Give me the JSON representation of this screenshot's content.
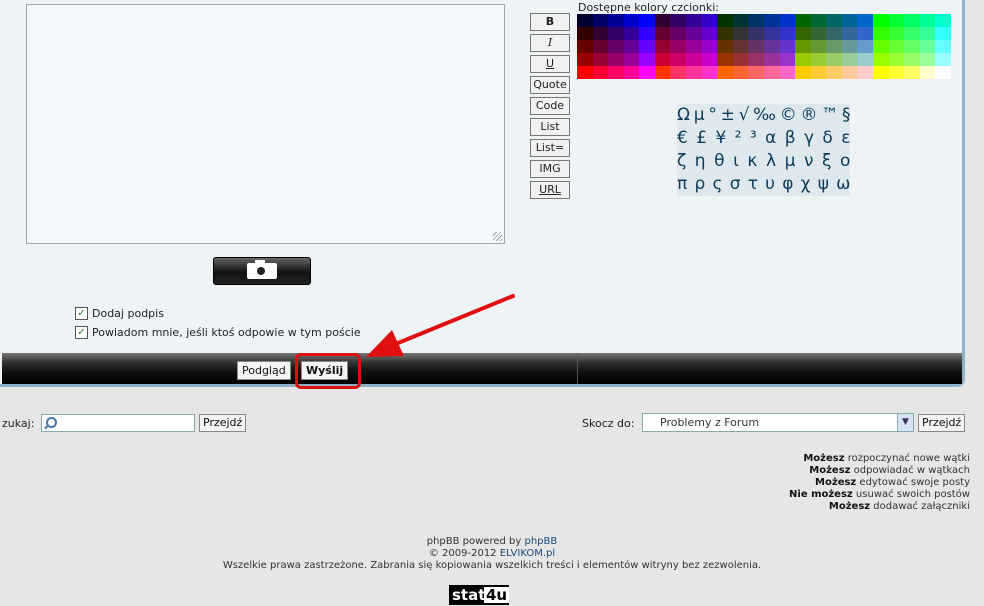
{
  "format_buttons": [
    "B",
    "I",
    "U",
    "Quote",
    "Code",
    "List",
    "List=",
    "IMG",
    "URL"
  ],
  "colors_label": "Dostępne kolory czcionki:",
  "palette_rows": [
    [
      "#000033",
      "#000066",
      "#000099",
      "#0000cc",
      "#0000ff",
      "#330033",
      "#330066",
      "#330099",
      "#3300cc",
      "#003300",
      "#003333",
      "#003366",
      "#003399",
      "#0033cc",
      "#006600",
      "#006633",
      "#006666",
      "#006699",
      "#0066cc",
      "#00ff00",
      "#00ff33",
      "#00ff66",
      "#00ff99",
      "#00ffcc"
    ],
    [
      "#330000",
      "#330033",
      "#330066",
      "#330099",
      "#3300ff",
      "#660033",
      "#660066",
      "#660099",
      "#6600cc",
      "#333300",
      "#333333",
      "#333366",
      "#333399",
      "#3333cc",
      "#336600",
      "#336633",
      "#336666",
      "#336699",
      "#3366cc",
      "#33ff00",
      "#33ff33",
      "#33ff66",
      "#33ff99",
      "#33ffff"
    ],
    [
      "#660000",
      "#660033",
      "#660066",
      "#660099",
      "#6600ff",
      "#990033",
      "#990066",
      "#990099",
      "#9900cc",
      "#663300",
      "#663333",
      "#663366",
      "#663399",
      "#6633cc",
      "#669900",
      "#669933",
      "#669966",
      "#669999",
      "#6699cc",
      "#66ff00",
      "#66ff33",
      "#66ff66",
      "#66ff99",
      "#66ffff"
    ],
    [
      "#990000",
      "#990033",
      "#990066",
      "#990099",
      "#9900ff",
      "#cc0033",
      "#cc0066",
      "#cc0099",
      "#cc00cc",
      "#993300",
      "#993333",
      "#993366",
      "#993399",
      "#9933cc",
      "#99cc00",
      "#99cc33",
      "#99cc66",
      "#99cc99",
      "#99cccc",
      "#99ff00",
      "#99ff33",
      "#99ff66",
      "#99ff99",
      "#99ffff"
    ],
    [
      "#ff0000",
      "#ff0033",
      "#ff0066",
      "#ff0099",
      "#ff00ff",
      "#ff3300",
      "#ff3366",
      "#ff3399",
      "#ff33cc",
      "#ff6600",
      "#ff6633",
      "#ff6666",
      "#ff6699",
      "#ff66cc",
      "#ffcc00",
      "#ffcc33",
      "#ffcc66",
      "#ffcc99",
      "#ffcccc",
      "#ffff00",
      "#ffff33",
      "#ffff66",
      "#ffffcc",
      "#ffffff"
    ]
  ],
  "symbol_rows": [
    [
      "Ω",
      "µ",
      "°",
      "±",
      "√",
      "‰",
      "©",
      "®",
      "™",
      "§"
    ],
    [
      "€",
      "£",
      "¥",
      "²",
      "³",
      "α",
      "β",
      "γ",
      "δ",
      "ε"
    ],
    [
      "ζ",
      "η",
      "θ",
      "ι",
      "κ",
      "λ",
      "μ",
      "ν",
      "ξ",
      "ο"
    ],
    [
      "π",
      "ρ",
      "ς",
      "σ",
      "τ",
      "υ",
      "φ",
      "χ",
      "ψ",
      "ω"
    ]
  ],
  "options": {
    "signature": "Dodaj podpis",
    "notify": "Powiadom mnie, jeśli ktoś odpowie w tym poście"
  },
  "actions": {
    "preview": "Podgląd",
    "submit": "Wyślij"
  },
  "search": {
    "label": "zukaj:",
    "go": "Przejdź"
  },
  "jump": {
    "label": "Skocz do:",
    "selected": "Problemy z Forum",
    "go": "Przejdź"
  },
  "permissions": [
    {
      "b": "Możesz",
      "t": " rozpoczynać nowe wątki"
    },
    {
      "b": "Możesz",
      "t": " odpowiadać w wątkach"
    },
    {
      "b": "Możesz",
      "t": " edytować swoje posty"
    },
    {
      "b": "Nie możesz",
      "t": " usuwać swoich postów"
    },
    {
      "b": "Możesz",
      "t": " dodawać załączniki"
    }
  ],
  "footer": {
    "powered_prefix": "phpBB powered by ",
    "powered_link": "phpBB",
    "copy_prefix": "© 2009-2012 ",
    "copy_link": "ELVIKOM.pl",
    "rights": "Wszelkie prawa zastrzeżone. Zabrania się kopiowania wszelkich treści i elementów witryny bez zezwolenia."
  },
  "stat_badge": {
    "a": "stat",
    "b": "4u"
  }
}
